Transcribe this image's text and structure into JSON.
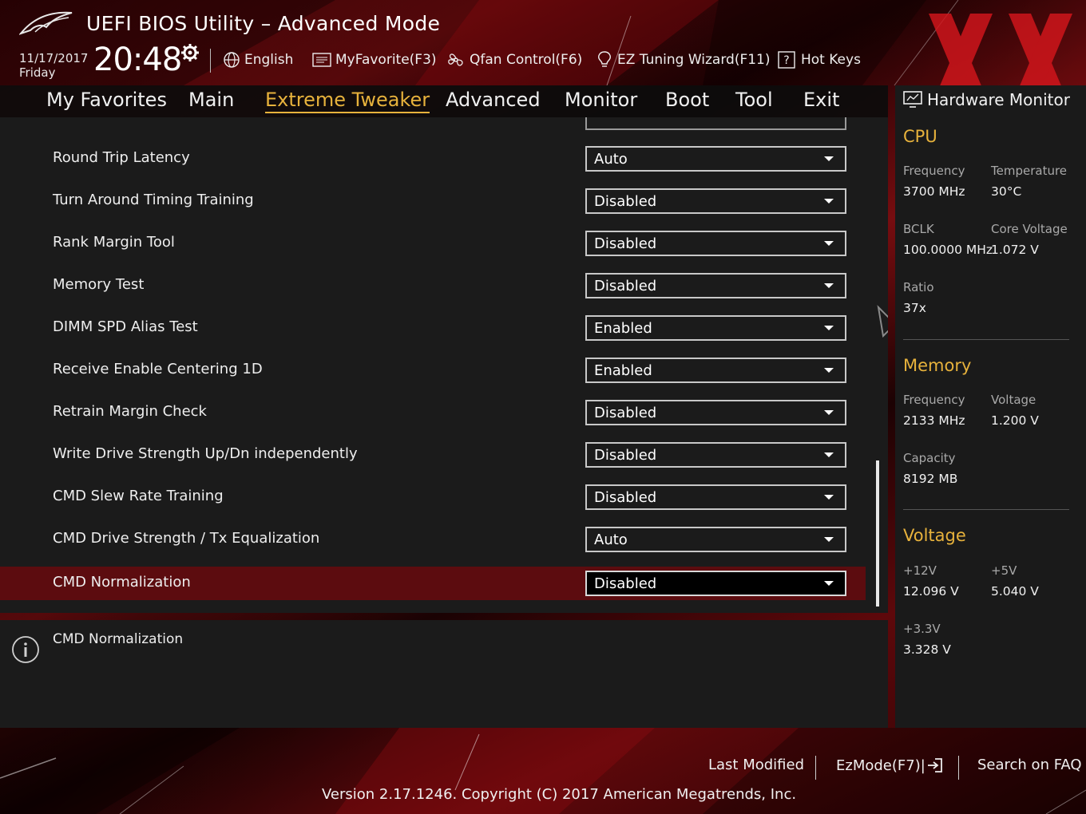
{
  "app": {
    "title": "UEFI BIOS Utility – Advanced Mode",
    "date": "11/17/2017",
    "weekday": "Friday",
    "time": "20:48"
  },
  "header": {
    "language": "English",
    "favorite": "MyFavorite(F3)",
    "qfan": "Qfan Control(F6)",
    "ez_tuning": "EZ Tuning Wizard(F11)",
    "hotkeys": "Hot Keys"
  },
  "tabs": [
    "My Favorites",
    "Main",
    "Extreme Tweaker",
    "Advanced",
    "Monitor",
    "Boot",
    "Tool",
    "Exit"
  ],
  "active_tab": "Extreme Tweaker",
  "settings": [
    {
      "label": "Round Trip Latency",
      "value": "Auto"
    },
    {
      "label": "Turn Around Timing Training",
      "value": "Disabled"
    },
    {
      "label": "Rank Margin Tool",
      "value": "Disabled"
    },
    {
      "label": "Memory Test",
      "value": "Disabled"
    },
    {
      "label": "DIMM SPD Alias Test",
      "value": "Enabled"
    },
    {
      "label": "Receive Enable Centering 1D",
      "value": "Enabled"
    },
    {
      "label": "Retrain Margin Check",
      "value": "Disabled"
    },
    {
      "label": "Write Drive Strength Up/Dn independently",
      "value": "Disabled"
    },
    {
      "label": "CMD Slew Rate Training",
      "value": "Disabled"
    },
    {
      "label": "CMD Drive Strength / Tx Equalization",
      "value": "Auto"
    },
    {
      "label": "CMD Normalization",
      "value": "Disabled"
    }
  ],
  "selected_setting": "CMD Normalization",
  "info": {
    "text": "CMD Normalization"
  },
  "hardware_monitor": {
    "title": "Hardware Monitor",
    "cpu": {
      "heading": "CPU",
      "frequency_label": "Frequency",
      "frequency": "3700 MHz",
      "temperature_label": "Temperature",
      "temperature": "30°C",
      "bclk_label": "BCLK",
      "bclk": "100.0000 MHz",
      "core_voltage_label": "Core Voltage",
      "core_voltage": "1.072 V",
      "ratio_label": "Ratio",
      "ratio": "37x"
    },
    "memory": {
      "heading": "Memory",
      "frequency_label": "Frequency",
      "frequency": "2133 MHz",
      "voltage_label": "Voltage",
      "voltage": "1.200 V",
      "capacity_label": "Capacity",
      "capacity": "8192 MB"
    },
    "voltage": {
      "heading": "Voltage",
      "v12_label": "+12V",
      "v12": "12.096 V",
      "v5_label": "+5V",
      "v5": "5.040 V",
      "v33_label": "+3.3V",
      "v33": "3.328 V"
    }
  },
  "footer": {
    "last_modified": "Last Modified",
    "ezmode": "EzMode(F7)|",
    "search_faq": "Search on FAQ",
    "version": "Version 2.17.1246. Copyright (C) 2017 American Megatrends, Inc."
  },
  "colors": {
    "accent": "#e7b23c",
    "selected_row": "#5c0c0f",
    "panel": "#1b1b1b",
    "watermark": "#d4161c"
  }
}
